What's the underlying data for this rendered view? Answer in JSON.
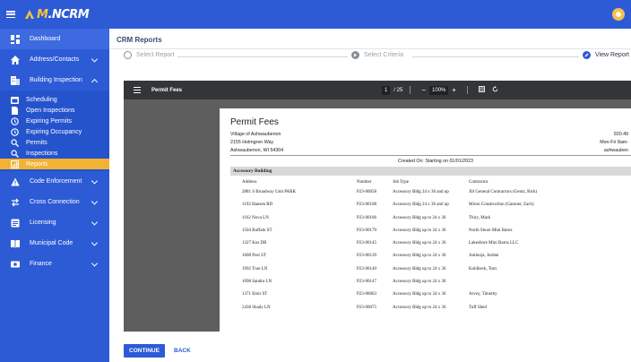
{
  "app": {
    "logo_m": "M",
    "logo_rest": ".NCRM"
  },
  "sidebar": {
    "items": [
      {
        "label": "Dashboard",
        "icon": "dashboard-icon"
      },
      {
        "label": "Address/Contacts",
        "icon": "home-icon"
      },
      {
        "label": "Building Inspection",
        "icon": "building-icon"
      },
      {
        "label": "Code Enforcement",
        "icon": "warning-icon"
      },
      {
        "label": "Cross Connection",
        "icon": "swap-icon"
      },
      {
        "label": "Licensing",
        "icon": "license-icon"
      },
      {
        "label": "Municipal Code",
        "icon": "book-icon"
      },
      {
        "label": "Finance",
        "icon": "finance-icon"
      }
    ],
    "building_sub": [
      {
        "label": "Scheduling",
        "icon": "calendar-icon"
      },
      {
        "label": "Open Inspections",
        "icon": "document-icon"
      },
      {
        "label": "Expiring Permits",
        "icon": "clock-icon"
      },
      {
        "label": "Expiring Occupancy",
        "icon": "clock-icon"
      },
      {
        "label": "Permits",
        "icon": "search-icon"
      },
      {
        "label": "Inspections",
        "icon": "search-icon"
      },
      {
        "label": "Reports",
        "icon": "report-icon"
      }
    ]
  },
  "main": {
    "title": "CRM Reports",
    "steps": [
      "Select Report",
      "Select Criteria",
      "View Report"
    ],
    "continue_label": "CONTINUE",
    "back_label": "BACK"
  },
  "viewer": {
    "doc_title": "Permit Fees",
    "page_current": "1",
    "page_total": "/ 25",
    "zoom": "100%"
  },
  "report": {
    "title": "Permit Fees",
    "org_lines": [
      "Village of Ashwaubenon",
      "2155 Holmgren Way",
      "Ashwaubenon, WI 54304"
    ],
    "right_lines": [
      "920.49",
      "Mon-Fri 8am-",
      "ashwauben"
    ],
    "created": "Created On: Starting on 01/01/2023",
    "group": "Accessory Building",
    "headers": [
      "Address",
      "Number",
      "Job Type",
      "Contractor"
    ],
    "rows": [
      [
        "2881 S Broadway Unit PARK",
        "P23-00058",
        "Accessory Bldg 24 x 36 and up",
        "Jill General Contractors (Gentz, Rick)"
      ],
      [
        "1192 Hansen RD",
        "P23-00108",
        "Accessory Bldg 24 x 36 and up",
        "Miron Construction (Gassner, Zach)"
      ],
      [
        "1162 Nova LN",
        "P23-00106",
        "Accessory Bldg up to 24 x 36",
        "Thiry, Mark"
      ],
      [
        "1504 Buffalo ST",
        "P23-00179",
        "Accessory Bldg up to 24 x 36",
        "North Shore Mini Barns"
      ],
      [
        "1327 Kos DR",
        "P23-00145",
        "Accessory Bldg up to 24 x 36",
        "Lakeshore Mini Barns LLC"
      ],
      [
        "1608 Post ST",
        "P23-00139",
        "Accessory Bldg up to 24 x 36",
        "Antinoja, Jordan"
      ],
      [
        "1992 True LN",
        "P23-00140",
        "Accessory Bldg up to 24 x 36",
        "Kohlbeck, Tom"
      ],
      [
        "1098 Sandra LN",
        "P23-00147",
        "Accessory Bldg up to 24 x 36",
        ""
      ],
      [
        "1371 Emir ST",
        "P23-00063",
        "Accessory Bldg up to 24 x 36",
        "Arvey, Timothy"
      ],
      [
        "2438 Shady LN",
        "P23-00075",
        "Accessory Bldg up to 24 x 36",
        "Tuff Shed"
      ]
    ]
  },
  "colors": {
    "brand_blue": "#2d5bd6",
    "active_yellow": "#f2b233"
  }
}
